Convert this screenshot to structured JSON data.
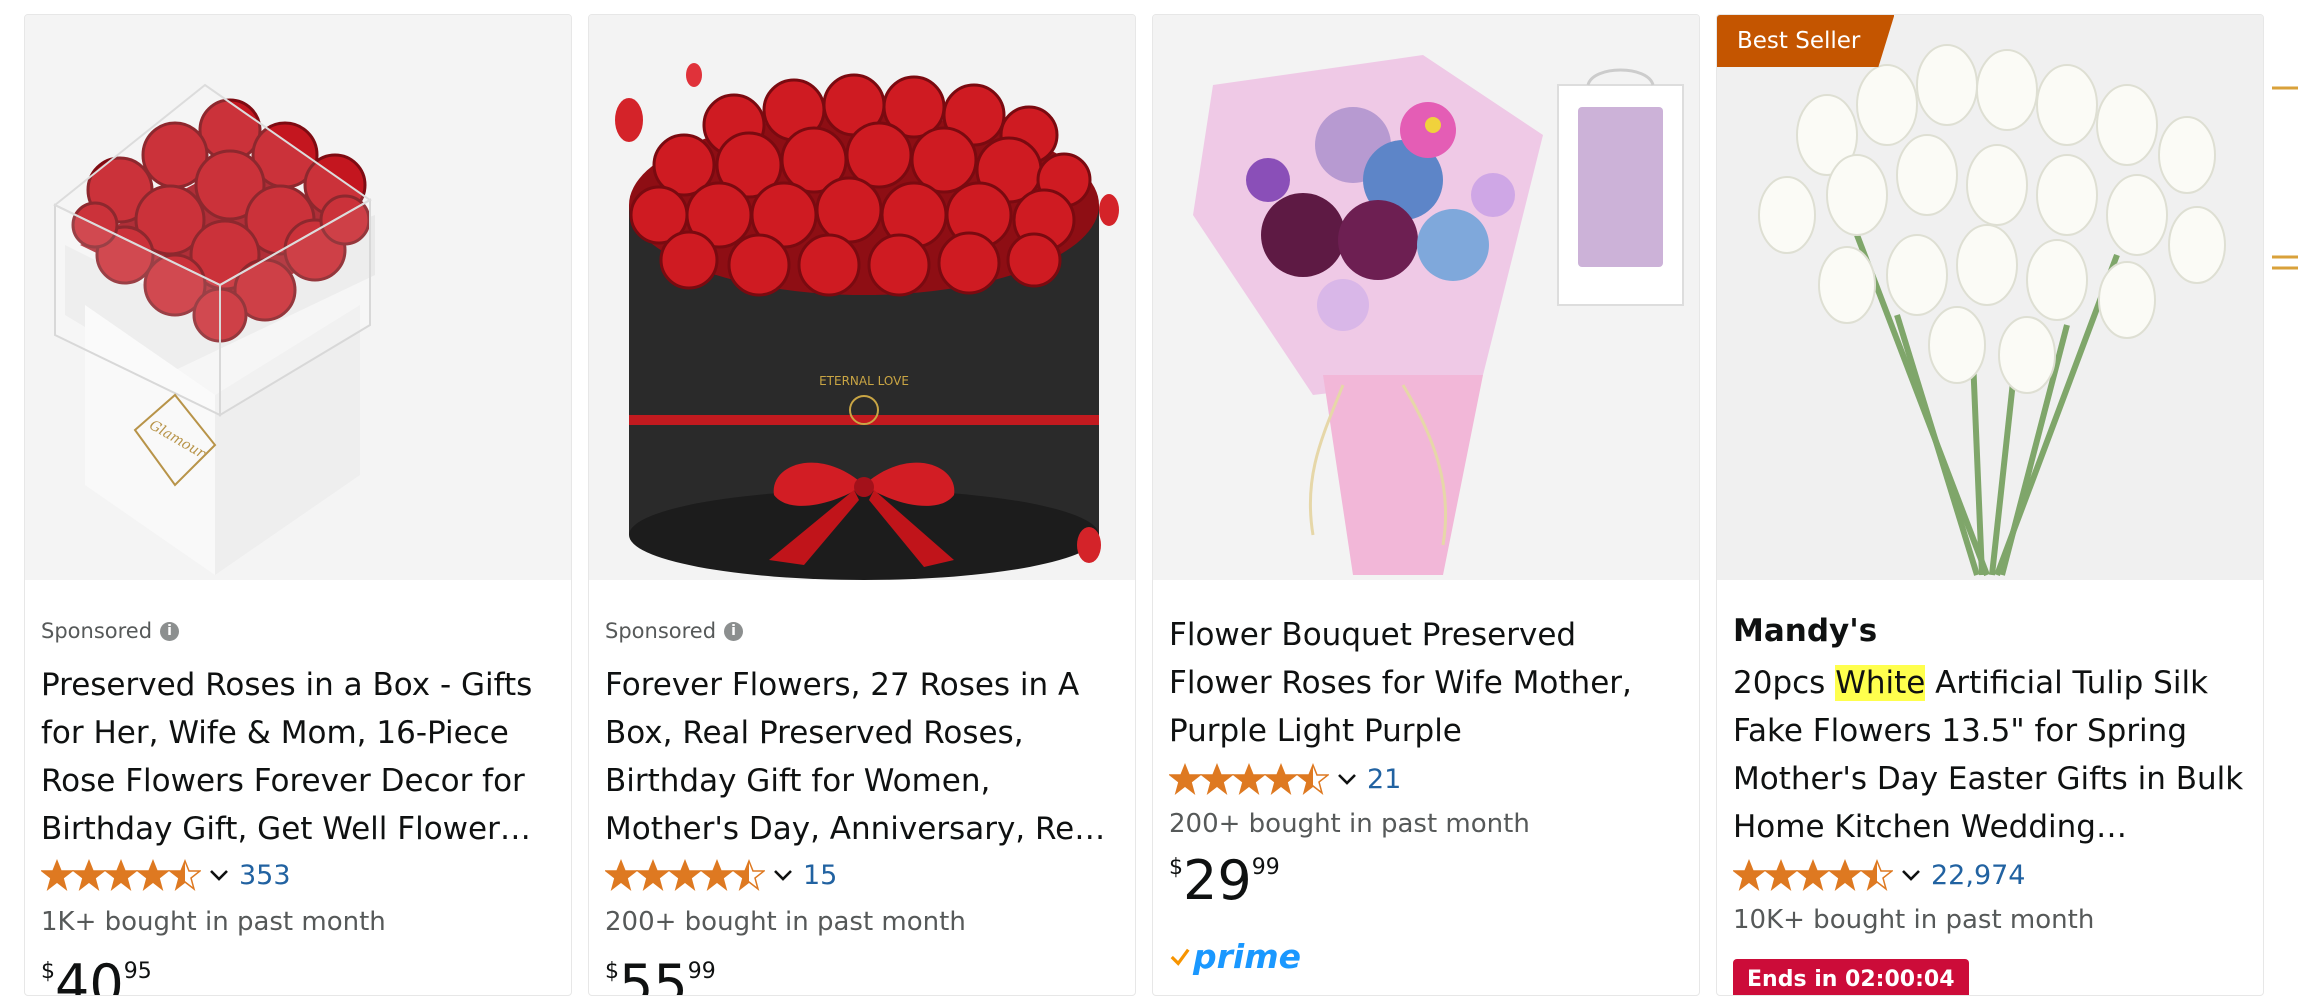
{
  "products": [
    {
      "sponsored": "Sponsored",
      "title": "Preserved Roses in a Box - Gifts for Her, Wife & Mom, 16-Piece Rose Flowers Forever Decor for Birthday Gift, Get Well Flower Bouquet…",
      "rating": 4.5,
      "review_count": "353",
      "bought": "1K+ bought in past month",
      "price": {
        "symbol": "$",
        "whole": "40",
        "fraction": "95"
      },
      "image_text": "Glamour Boutique"
    },
    {
      "sponsored": "Sponsored",
      "title": "Forever Flowers, 27 Roses in A Box, Real Preserved Roses, Birthday Gift for Women, Mother's Day, Anniversary, Red Rose",
      "rating": 4.5,
      "review_count": "15",
      "bought": "200+ bought in past month",
      "price": {
        "symbol": "$",
        "whole": "55",
        "fraction": "99"
      },
      "image_text": "ETERNAL LOVE"
    },
    {
      "title": "Flower Bouquet Preserved Flower Roses for Wife Mother, Purple Light Purple",
      "rating": 4.5,
      "review_count": "21",
      "bought": "200+ bought in past month",
      "price": {
        "symbol": "$",
        "whole": "29",
        "fraction": "99"
      },
      "prime": "prime"
    },
    {
      "badge": "Best Seller",
      "brand": "Mandy's",
      "title_pre": "20pcs ",
      "title_highlight": "White",
      "title_post": " Artificial Tulip Silk Fake Flowers 13.5\" for Spring Mother's Day Easter Gifts in Bulk Home Kitchen Wedding…",
      "rating": 4.5,
      "review_count": "22,974",
      "bought": "10K+ bought in past month",
      "deal": "Ends in 02:00:04"
    }
  ],
  "icons": {
    "info": "i",
    "star_color": "#de7921",
    "link_color": "#2162a1",
    "badge_color": "#c45500",
    "deal_color": "#cc0c39",
    "highlight_color": "#ffff4d"
  }
}
